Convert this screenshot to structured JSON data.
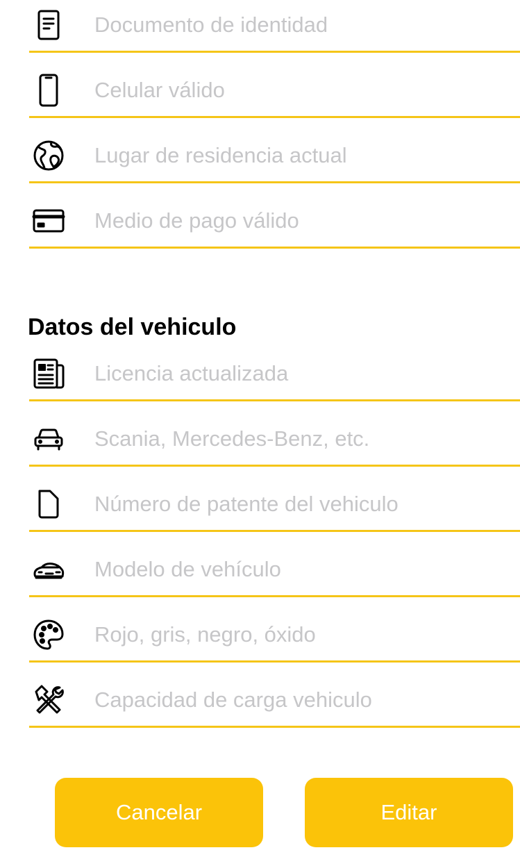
{
  "personal_fields": [
    {
      "placeholder": "Documento de identidad",
      "icon": "document-icon"
    },
    {
      "placeholder": "Celular válido",
      "icon": "phone-icon"
    },
    {
      "placeholder": "Lugar de residencia actual",
      "icon": "globe-icon"
    },
    {
      "placeholder": "Medio de pago válido",
      "icon": "credit-card-icon"
    }
  ],
  "vehicle_section": {
    "title": "Datos del vehiculo",
    "fields": [
      {
        "placeholder": "Licencia actualizada",
        "icon": "newspaper-icon"
      },
      {
        "placeholder": "Scania, Mercedes-Benz, etc.",
        "icon": "car-icon"
      },
      {
        "placeholder": "Número de patente del vehiculo",
        "icon": "file-icon"
      },
      {
        "placeholder": "Modelo de vehículo",
        "icon": "car-side-icon"
      },
      {
        "placeholder": "Rojo, gris, negro, óxido",
        "icon": "palette-icon"
      },
      {
        "placeholder": "Capacidad de carga vehiculo",
        "icon": "tools-icon"
      }
    ]
  },
  "actions": {
    "cancel_label": "Cancelar",
    "edit_label": "Editar"
  },
  "colors": {
    "accent": "#FBC309",
    "underline": "#F5C518",
    "placeholder": "#C6C6C8"
  }
}
